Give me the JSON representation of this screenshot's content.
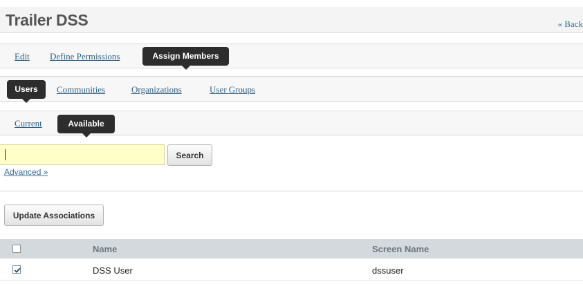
{
  "header": {
    "title": "Trailer DSS",
    "back_link": "« Back"
  },
  "tabs_primary": {
    "edit": "Edit",
    "define_permissions": "Define Permissions",
    "assign_members": "Assign Members"
  },
  "tabs_secondary": {
    "users": "Users",
    "communities": "Communities",
    "organizations": "Organizations",
    "user_groups": "User Groups"
  },
  "tabs_tertiary": {
    "current": "Current",
    "available": "Available"
  },
  "search": {
    "value": "",
    "button": "Search",
    "advanced": "Advanced »"
  },
  "actions": {
    "update_associations": "Update Associations"
  },
  "table": {
    "columns": {
      "name": "Name",
      "screen_name": "Screen Name"
    },
    "header_checked": false,
    "rows": [
      {
        "checked": true,
        "name": "DSS User",
        "screen_name": "dssuser"
      }
    ]
  }
}
